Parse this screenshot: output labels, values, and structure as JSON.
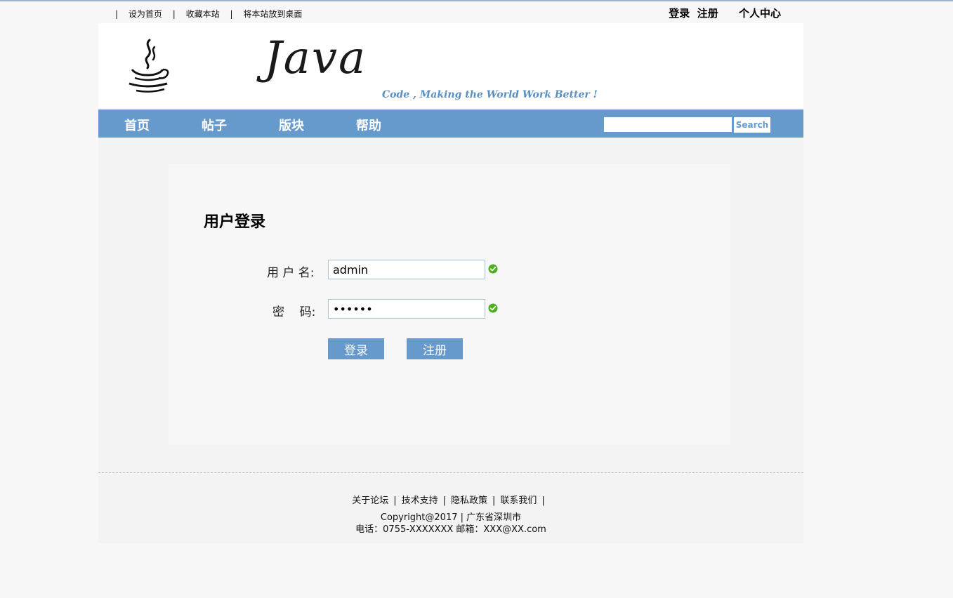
{
  "topbar": {
    "separator": "|",
    "links": [
      "设为首页",
      "收藏本站",
      "将本站放到桌面"
    ],
    "login": "登录",
    "register": "注册",
    "user_center": "个人中心"
  },
  "banner": {
    "logo_text": "Java",
    "slogan": "Code , Making the World Work Better !"
  },
  "nav": {
    "items": [
      "首页",
      "帖子",
      "版块",
      "帮助"
    ],
    "search_value": "",
    "search_button": "Search"
  },
  "login_form": {
    "title": "用户登录",
    "username_label": "用 户 名:",
    "username_value": "admin",
    "password_label": "密    码:",
    "password_value": "••••••",
    "login_button": "登录",
    "register_button": "注册"
  },
  "footer": {
    "links": [
      "关于论坛",
      "技术支持",
      "隐私政策",
      "联系我们"
    ],
    "separator": "|",
    "copyright": "Copyright@2017 | 广东省深圳市",
    "contact": "电话：0755-XXXXXXX 邮箱：XXX@XX.com"
  },
  "colors": {
    "accent": "#6699cc",
    "valid_icon": "#4caf1f"
  },
  "icons": {
    "logo": "coffee-cup-icon",
    "valid": "check-circle-icon"
  }
}
